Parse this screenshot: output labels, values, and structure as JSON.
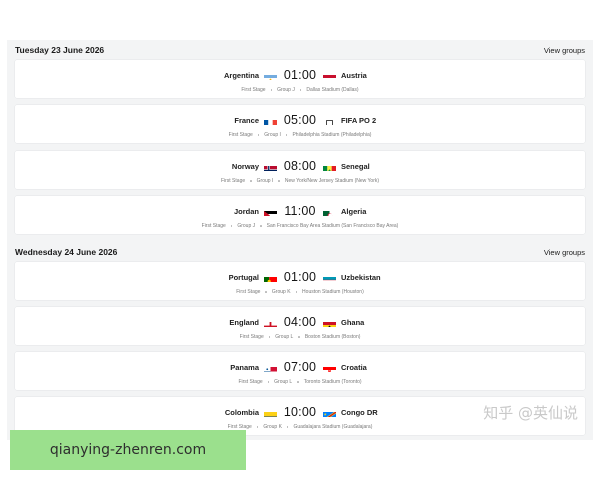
{
  "days": [
    {
      "title": "Tuesday 23 June 2026",
      "view_groups": "View groups",
      "matches": [
        {
          "home": "Argentina",
          "time": "01:00",
          "away": "Austria",
          "stage": "First Stage",
          "group": "Group J",
          "venue": "Dallas Stadium (Dallas)"
        },
        {
          "home": "France",
          "time": "05:00",
          "away": "FIFA PO 2",
          "stage": "First Stage",
          "group": "Group I",
          "venue": "Philadelphia Stadium (Philadelphia)"
        },
        {
          "home": "Norway",
          "time": "08:00",
          "away": "Senegal",
          "stage": "First Stage",
          "group": "Group I",
          "venue": "New York/New Jersey Stadium (New York)"
        },
        {
          "home": "Jordan",
          "time": "11:00",
          "away": "Algeria",
          "stage": "First Stage",
          "group": "Group J",
          "venue": "San Francisco Bay Area Stadium (San Francisco Bay Area)"
        }
      ]
    },
    {
      "title": "Wednesday 24 June 2026",
      "view_groups": "View groups",
      "matches": [
        {
          "home": "Portugal",
          "time": "01:00",
          "away": "Uzbekistan",
          "stage": "First Stage",
          "group": "Group K",
          "venue": "Houston Stadium (Houston)"
        },
        {
          "home": "England",
          "time": "04:00",
          "away": "Ghana",
          "stage": "First Stage",
          "group": "Group L",
          "venue": "Boston Stadium (Boston)"
        },
        {
          "home": "Panama",
          "time": "07:00",
          "away": "Croatia",
          "stage": "First Stage",
          "group": "Group L",
          "venue": "Toronto Stadium (Toronto)"
        },
        {
          "home": "Colombia",
          "time": "10:00",
          "away": "Congo DR",
          "stage": "First Stage",
          "group": "Group K",
          "venue": "Guadalajara Stadium (Guadalajara)"
        }
      ]
    }
  ],
  "watermark": "知乎 @英仙说",
  "overlay_label": "qianying-zhenren.com"
}
